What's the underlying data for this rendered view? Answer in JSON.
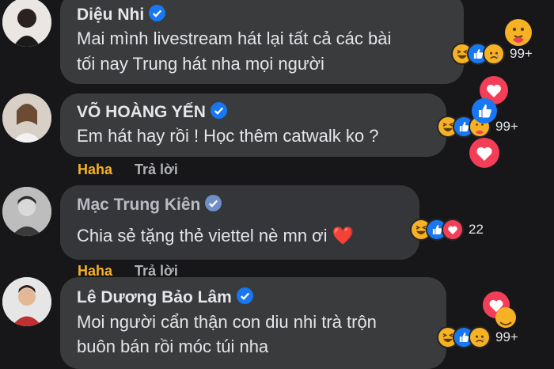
{
  "comments": [
    {
      "name": "Diệu Nhi",
      "lines": [
        "Mai mình livestream hát lại tất cả các bài",
        "tối nay Trung hát nha mọi người"
      ],
      "reaction_count": "99+"
    },
    {
      "name": "VÕ HOÀNG YẾN",
      "lines": [
        "Em hát hay rồi ! Học thêm catwalk ko ?"
      ],
      "reaction_count": "99+",
      "actions": {
        "haha": "Haha",
        "reply": "Trả lời"
      }
    },
    {
      "name": "Mạc Trung Kiên",
      "lines": [
        "Chia sẻ tặng thẻ viettel nè mn ơi ❤️"
      ],
      "reaction_count": "22",
      "actions": {
        "haha": "Haha",
        "reply": "Trả lời"
      }
    },
    {
      "name": "Lê Dương Bảo Lâm",
      "lines": [
        "Moi người cẩn thận con diu nhi trà trộn",
        "buôn bán rồi móc túi nha"
      ],
      "reaction_count": "99+"
    }
  ],
  "colors": {
    "background": "#17171a",
    "bubble": "#3a3b3c",
    "haha": "#f7b125",
    "verified": "#1877f2",
    "like": "#1877f2",
    "love": "#f33e58"
  },
  "icons": [
    "verified-badge-icon",
    "haha-emoji-icon",
    "like-icon",
    "love-icon",
    "care-emoji-icon",
    "sad-emoji-icon"
  ]
}
